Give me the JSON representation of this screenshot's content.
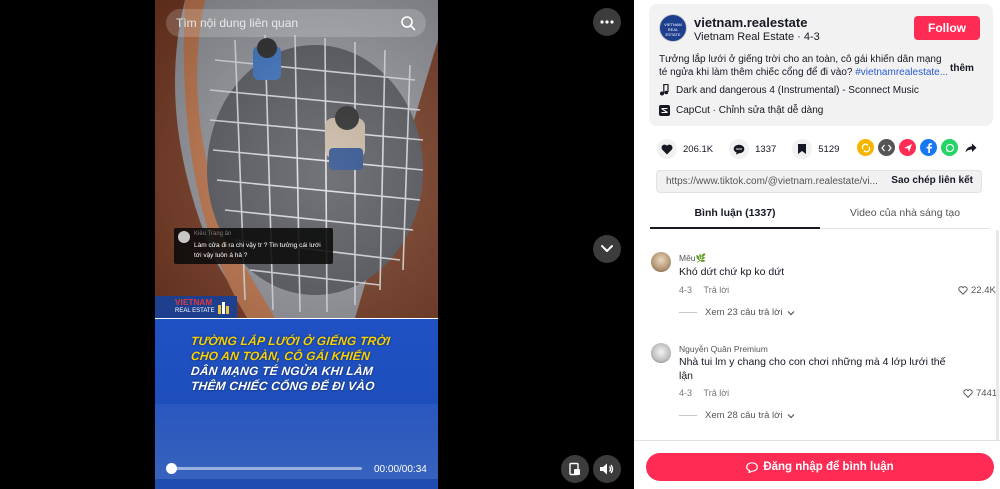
{
  "search": {
    "placeholder": "Tìm nội dung liên quan"
  },
  "video": {
    "overlay_comment": {
      "user": "Kiều Trang ân",
      "text": "Làm cửa đi ra chi vậy tr ? Tin tưởng cái lưới tới vậy luôn á hả ?"
    },
    "logo": {
      "line1": "VIETNAM",
      "line2": "REAL ESTATE"
    },
    "caption": [
      "TƯỜNG LẮP LƯỚI Ở GIẾNG TRỜI",
      "CHO AN TOÀN, CÔ GÁI KHIẾN",
      "DÂN MẠNG TÉ NGỬA KHI LÀM",
      "THÊM CHIẾC CỔNG ĐỂ ĐI VÀO"
    ],
    "time": "00:00/00:34",
    "progress": 0
  },
  "author": {
    "avatar_text": "VIETNAM REAL ESTATE",
    "username": "vietnam.realestate",
    "display_name": "Vietnam Real Estate",
    "date": "4-3",
    "separator": " · ",
    "follow_label": "Follow"
  },
  "description": {
    "text": "Tưởng lắp lưới ở giếng trời cho an toàn, cô gái khiến dân mạng té ngửa khi làm thêm chiếc cổng để đi vào? ",
    "hashtag": "#vietnamrealestate...",
    "more_label": "thêm"
  },
  "music": {
    "title": "Dark and dangerous 4 (Instrumental) - Sconnect Music"
  },
  "capcut": {
    "text": "CapCut · Chỉnh sửa thật dễ dàng"
  },
  "stats": {
    "likes": "206.1K",
    "comments": "1337",
    "saves": "5129"
  },
  "share_icons": [
    "repost-icon",
    "embed-icon",
    "send-icon",
    "facebook-icon",
    "whatsapp-icon",
    "share-arrow-icon"
  ],
  "link": {
    "url": "https://www.tiktok.com/@vietnam.realestate/vi...",
    "copy_label": "Sao chép liên kết"
  },
  "tabs": {
    "comments": "Bình luận (1337)",
    "creator": "Video của nhà sáng tạo"
  },
  "comments": [
    {
      "user": "Mêu🌿",
      "text": "Khó dứt chứ kp ko dứt",
      "date": "4-3",
      "reply_label": "Trả lời",
      "likes": "22.4K",
      "replies": "Xem 23 câu trả lời"
    },
    {
      "user": "Nguyễn Quân Premium",
      "text": "Nhà tui lm y chang cho con chơi những mà 4 lớp lưới thế lận",
      "date": "4-3",
      "reply_label": "Trả lời",
      "likes": "7441",
      "replies": "Xem 28 câu trả lời"
    }
  ],
  "login": {
    "label": "Đăng nhập để bình luận"
  },
  "colors": {
    "accent": "#fe2c55",
    "hashtag": "#2b5bd3",
    "caption_yellow": "#f7d100",
    "caption_bg": "#2051c4"
  }
}
